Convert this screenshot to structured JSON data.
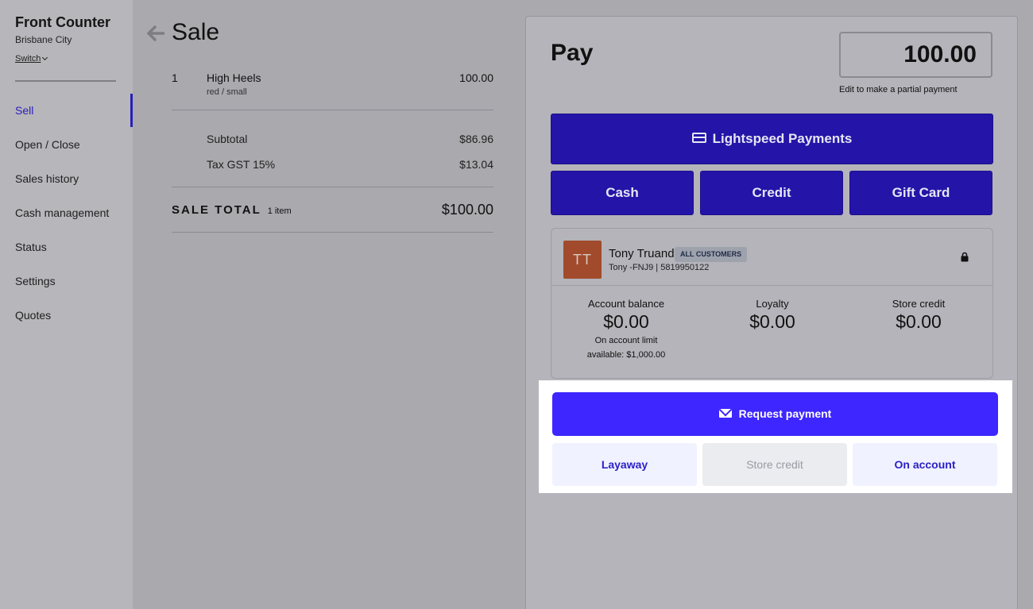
{
  "sidebar": {
    "title": "Front Counter",
    "location": "Brisbane City",
    "switch_label": "Switch",
    "items": [
      {
        "label": "Sell",
        "active": true
      },
      {
        "label": "Open / Close"
      },
      {
        "label": "Sales history"
      },
      {
        "label": "Cash management"
      },
      {
        "label": "Status"
      },
      {
        "label": "Settings"
      },
      {
        "label": "Quotes"
      }
    ]
  },
  "sale": {
    "title": "Sale",
    "line": {
      "qty": "1",
      "name": "High Heels",
      "variant": "red / small",
      "price": "100.00"
    },
    "subtotal_label": "Subtotal",
    "subtotal_value": "$86.96",
    "tax_label": "Tax GST 15%",
    "tax_value": "$13.04",
    "total_label": "SALE TOTAL",
    "total_count": "1 item",
    "total_value": "$100.00"
  },
  "pay": {
    "title": "Pay",
    "amount": "100.00",
    "amount_hint": "Edit to make a partial payment",
    "methods": {
      "lightspeed": "Lightspeed Payments",
      "cash": "Cash",
      "credit": "Credit",
      "gift_card": "Gift Card"
    },
    "customer": {
      "initials": "TT",
      "name": "Tony Truand",
      "group": "ALL CUSTOMERS",
      "meta": "Tony -FNJ9 | 5819950122",
      "account_balance_label": "Account balance",
      "account_balance": "$0.00",
      "account_limit_note": "On account limit available: $1,000.00",
      "loyalty_label": "Loyalty",
      "loyalty": "$0.00",
      "store_credit_label": "Store credit",
      "store_credit": "$0.00"
    },
    "request_payment": "Request payment",
    "layaway": "Layaway",
    "store_credit": "Store credit",
    "on_account": "On account"
  },
  "colors": {
    "accent": "#3d26ff",
    "accent_text": "#2b1fc7",
    "avatar": "#a14b2c"
  }
}
